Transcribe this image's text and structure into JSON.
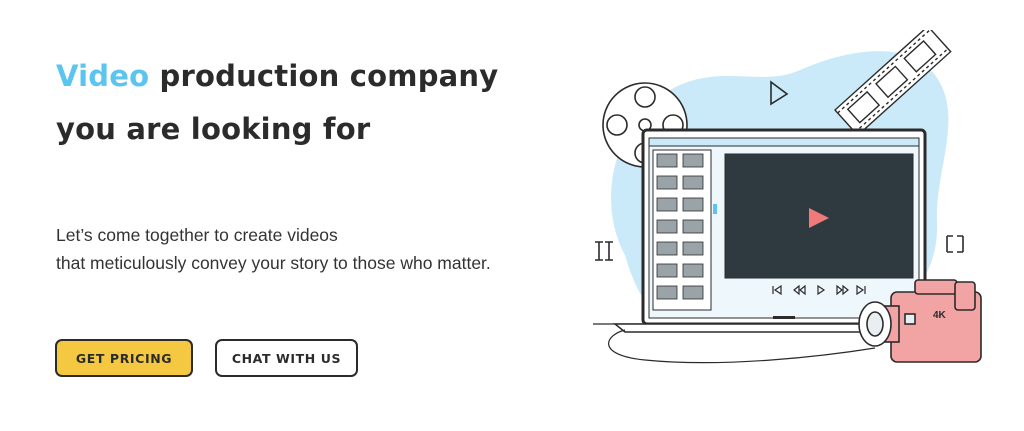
{
  "hero": {
    "headline_accent": "Video",
    "headline_rest": " production company you are looking for",
    "subtitle_line1": "Let’s come together to create videos",
    "subtitle_line2": "that meticulously convey your story to those who matter.",
    "buttons": {
      "pricing_label": "GET PRICING",
      "chat_label": "CHAT WITH US"
    }
  },
  "illustration": {
    "camera_badge": "4K",
    "icons": [
      "film-reel-icon",
      "film-strip-icon",
      "play-outline-icon",
      "play-icon",
      "video-camera-icon",
      "laptop-icon"
    ]
  },
  "colors": {
    "accent": "#5bc4ef",
    "button_yellow": "#f5c842",
    "blob_blue": "#cbeaf9",
    "play_red": "#f07a7a",
    "camera_pink": "#f2a3a3",
    "screen_dark": "#2f3a40"
  }
}
